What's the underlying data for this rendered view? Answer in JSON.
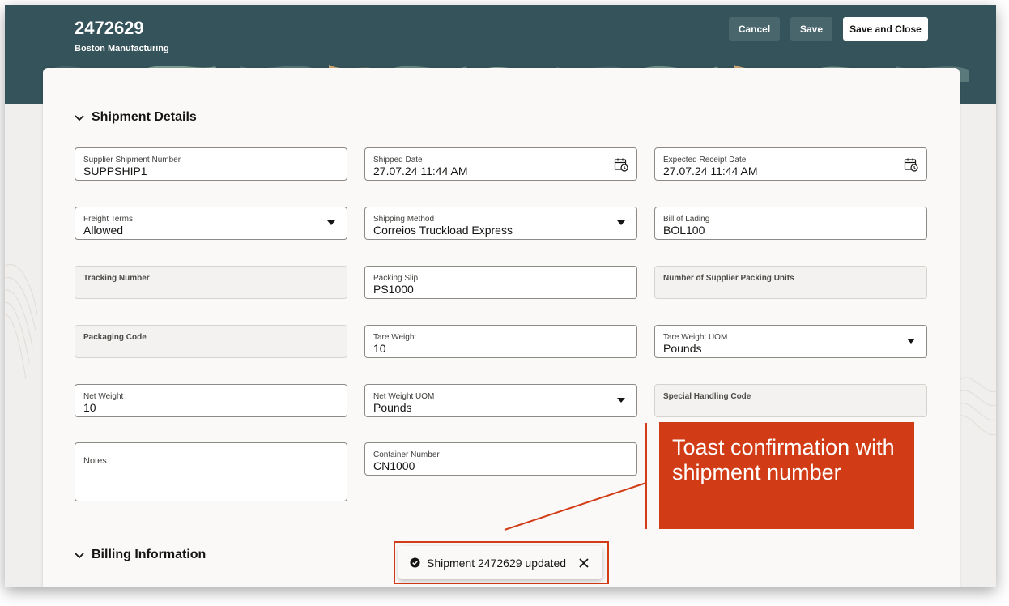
{
  "header": {
    "title": "2472629",
    "subtitle": "Boston Manufacturing",
    "buttons": {
      "cancel": "Cancel",
      "save": "Save",
      "save_close": "Save and Close"
    }
  },
  "sections": {
    "shipment_details": "Shipment Details",
    "billing_information": "Billing Information"
  },
  "fields": {
    "supplier_shipment_number": {
      "label": "Supplier Shipment Number",
      "value": "SUPPSHIP1"
    },
    "shipped_date": {
      "label": "Shipped Date",
      "value": "27.07.24 11:44 AM"
    },
    "expected_receipt_date": {
      "label": "Expected Receipt Date",
      "value": "27.07.24 11:44 AM"
    },
    "freight_terms": {
      "label": "Freight Terms",
      "value": "Allowed"
    },
    "shipping_method": {
      "label": "Shipping Method",
      "value": "Correios Truckload Express"
    },
    "bill_of_lading": {
      "label": "Bill of Lading",
      "value": "BOL100"
    },
    "tracking_number": {
      "label": "Tracking Number",
      "value": ""
    },
    "packing_slip": {
      "label": "Packing Slip",
      "value": "PS1000"
    },
    "supplier_packing_units": {
      "label": "Number of Supplier Packing Units",
      "value": ""
    },
    "packaging_code": {
      "label": "Packaging Code",
      "value": ""
    },
    "tare_weight": {
      "label": "Tare Weight",
      "value": "10"
    },
    "tare_weight_uom": {
      "label": "Tare Weight UOM",
      "value": "Pounds"
    },
    "net_weight": {
      "label": "Net Weight",
      "value": "10"
    },
    "net_weight_uom": {
      "label": "Net Weight UOM",
      "value": "Pounds"
    },
    "special_handling_code": {
      "label": "Special Handling Code",
      "value": ""
    },
    "notes": {
      "label": "Notes",
      "value": ""
    },
    "container_number": {
      "label": "Container Number",
      "value": "CN1000"
    }
  },
  "toast": {
    "message": "Shipment 2472629 updated",
    "icon": "check-circle-icon"
  },
  "callout": {
    "text": "Toast confirmation with shipment number"
  },
  "colors": {
    "header_bg": "#35535a",
    "callout": "#d13b15",
    "card_bg": "#fbf9f8"
  }
}
